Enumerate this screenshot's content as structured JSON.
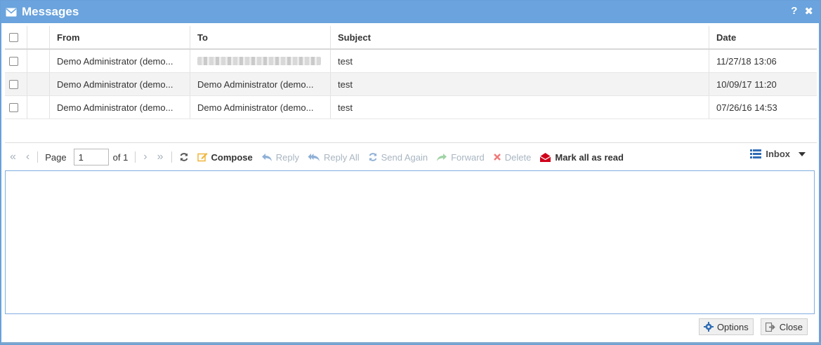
{
  "window": {
    "title": "Messages",
    "help_label": "?",
    "close_label": "✖"
  },
  "grid": {
    "columns": [
      "From",
      "To",
      "Subject",
      "Date"
    ],
    "rows": [
      {
        "from": "Demo Administrator (demo...",
        "to": "",
        "subject": "test",
        "date": "11/27/18 13:06"
      },
      {
        "from": "Demo Administrator (demo...",
        "to": "Demo Administrator (demo...",
        "subject": "test",
        "date": "10/09/17 11:20"
      },
      {
        "from": "Demo Administrator (demo...",
        "to": "Demo Administrator (demo...",
        "subject": "test",
        "date": "07/26/16 14:53"
      }
    ]
  },
  "pager": {
    "page_label": "Page",
    "page_value": "1",
    "of_label": "of 1"
  },
  "toolbar": {
    "compose": "Compose",
    "reply": "Reply",
    "reply_all": "Reply All",
    "send_again": "Send Again",
    "forward": "Forward",
    "delete": "Delete",
    "mark_all_read": "Mark all as read",
    "inbox": "Inbox"
  },
  "footer": {
    "options": "Options",
    "close": "Close"
  },
  "colors": {
    "titlebar": "#6aa3dd",
    "accent_red": "#d0021b",
    "compose_yellow": "#f0b53a",
    "preview_border": "#80aee0"
  }
}
